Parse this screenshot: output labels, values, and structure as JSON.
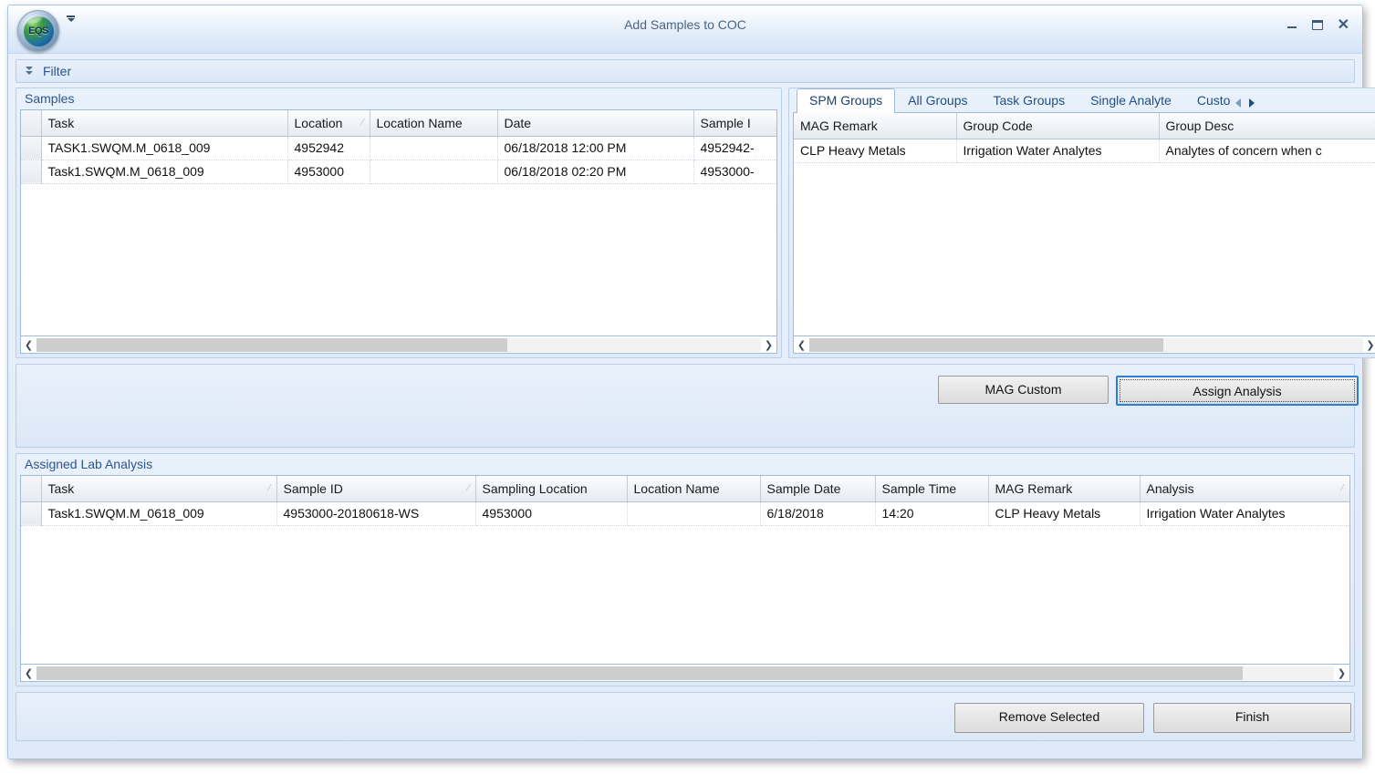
{
  "window": {
    "title": "Add Samples to COC",
    "logo_text": "EQS",
    "controls": {
      "minimize": "–",
      "maximize": "□",
      "close": "✕"
    }
  },
  "filter": {
    "label": "Filter"
  },
  "samples": {
    "caption": "Samples",
    "columns": [
      "Task",
      "Location",
      "Location Name",
      "Date",
      "Sample I"
    ],
    "sorted_column": "Location",
    "sort_direction": "asc",
    "rows": [
      {
        "task": "TASK1.SWQM.M_0618_009",
        "location": "4952942",
        "location_name": "",
        "date": "06/18/2018 12:00 PM",
        "sample_id": "4952942-"
      },
      {
        "task": "Task1.SWQM.M_0618_009",
        "location": "4953000",
        "location_name": "",
        "date": "06/18/2018 02:20 PM",
        "sample_id": "4953000-"
      }
    ],
    "scroll_left_arrow": "❮",
    "scroll_right_arrow": "❯"
  },
  "groups": {
    "tabs": [
      {
        "label": "SPM Groups",
        "active": true
      },
      {
        "label": "All Groups",
        "active": false
      },
      {
        "label": "Task Groups",
        "active": false
      },
      {
        "label": "Single Analyte",
        "active": false
      },
      {
        "label": "Custo",
        "active": false
      }
    ],
    "columns": [
      "MAG Remark",
      "Group Code",
      "Group Desc"
    ],
    "rows": [
      {
        "mag_remark": "CLP Heavy Metals",
        "group_code": "Irrigation Water Analytes",
        "group_desc": "Analytes of concern when c"
      }
    ],
    "scroll_left_arrow": "❮",
    "scroll_right_arrow": "❯"
  },
  "actions": {
    "mag_custom_label": "MAG Custom",
    "assign_analysis_label": "Assign Analysis"
  },
  "assigned": {
    "caption": "Assigned Lab Analysis",
    "columns": [
      "Task",
      "Sample ID",
      "Sampling Location",
      "Location Name",
      "Sample Date",
      "Sample Time",
      "MAG Remark",
      "Analysis"
    ],
    "sorted_columns": [
      "Task",
      "Sample ID",
      "Analysis"
    ],
    "rows": [
      {
        "task": "Task1.SWQM.M_0618_009",
        "sample_id": "4953000-20180618-WS",
        "sampling_location": "4953000",
        "location_name": "",
        "sample_date": "6/18/2018",
        "sample_time": "14:20",
        "mag_remark": "CLP Heavy Metals",
        "analysis": "Irrigation Water Analytes"
      }
    ],
    "scroll_left_arrow": "❮",
    "scroll_right_arrow": "❯"
  },
  "footer": {
    "remove_selected_label": "Remove Selected",
    "finish_label": "Finish"
  },
  "colors": {
    "accent_blue": "#2a7fd4",
    "caption_text": "#2a5590",
    "panel_border": "#b9cfe8",
    "grid_border": "#9dbcdd",
    "scroll_thumb": "#cdcdcd"
  },
  "icons": {
    "filter_expand": "double-chevron-down",
    "sort_ascending": "⁄"
  }
}
